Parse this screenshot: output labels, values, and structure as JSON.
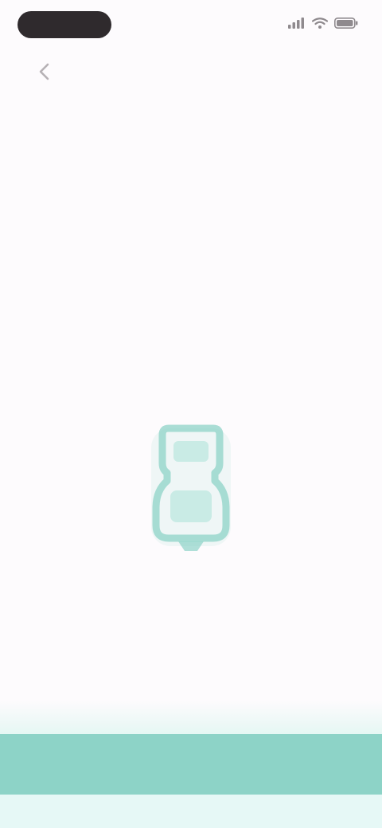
{
  "status_bar": {
    "time": "",
    "icons": [
      "signal-icon",
      "wifi-icon",
      "battery-icon"
    ]
  },
  "header": {
    "back_icon": "chevron-left-icon",
    "title": "",
    "description_line_1": "",
    "description_line_2": ""
  },
  "illustration": {
    "icon": "device-icon",
    "color": "#8dd3c7"
  },
  "hint": {
    "text": ""
  },
  "footer": {
    "button_label": "",
    "accent_color": "#8dd3c7"
  }
}
